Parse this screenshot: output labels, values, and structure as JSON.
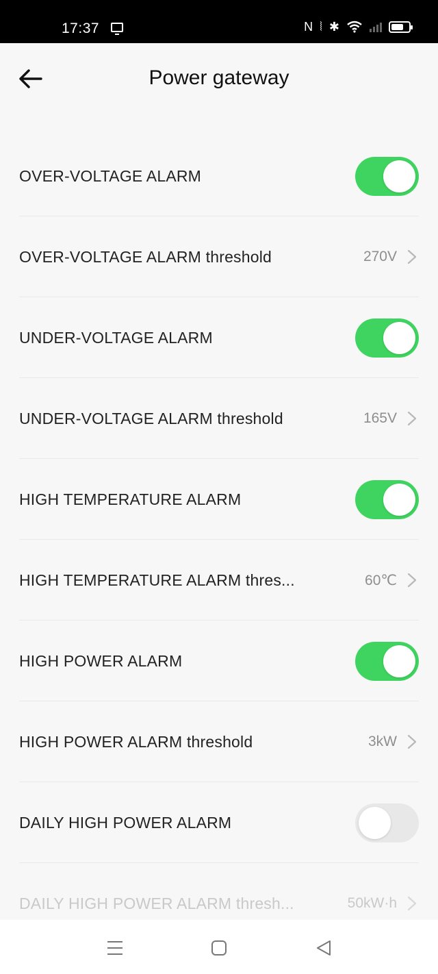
{
  "status_bar": {
    "time": "17:37",
    "icons": [
      "screen-cast-icon",
      "nfc-icon",
      "vibrate-icon",
      "bluetooth-icon",
      "wifi-icon",
      "signal-icon",
      "battery-icon"
    ],
    "nfc": "N",
    "vibrate": "⦚",
    "bluetooth": "✱"
  },
  "header": {
    "title": "Power gateway",
    "back_icon": "arrow-left-icon"
  },
  "settings": {
    "over_voltage_alarm": {
      "label": "OVER-VOLTAGE ALARM",
      "enabled": true
    },
    "over_voltage_threshold": {
      "label": "OVER-VOLTAGE ALARM threshold",
      "value": "270V"
    },
    "under_voltage_alarm": {
      "label": "UNDER-VOLTAGE ALARM",
      "enabled": true
    },
    "under_voltage_threshold": {
      "label": "UNDER-VOLTAGE ALARM threshold",
      "value": "165V"
    },
    "high_temperature_alarm": {
      "label": "HIGH TEMPERATURE ALARM",
      "enabled": true
    },
    "high_temperature_threshold": {
      "label": "HIGH TEMPERATURE ALARM thres...",
      "value": "60℃"
    },
    "high_power_alarm": {
      "label": "HIGH POWER ALARM",
      "enabled": true
    },
    "high_power_threshold": {
      "label": "HIGH POWER ALARM threshold",
      "value": "3kW"
    },
    "daily_high_power_alarm": {
      "label": "DAILY HIGH POWER ALARM",
      "enabled": false
    },
    "daily_high_power_threshold": {
      "label": "DAILY HIGH POWER ALARM thresh...",
      "value": "50kW·h",
      "disabled": true
    }
  },
  "colors": {
    "toggle_on": "#3fd45f",
    "toggle_off": "#e8e8e8",
    "background": "#f7f7f7"
  },
  "nav_bar": {
    "icons": [
      "menu-icon",
      "home-icon",
      "back-triangle-icon"
    ]
  }
}
